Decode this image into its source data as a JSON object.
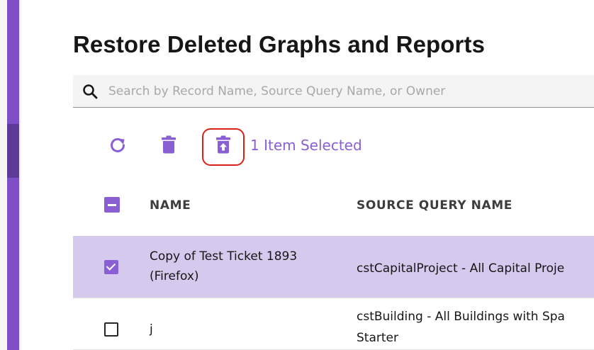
{
  "page": {
    "title": "Restore Deleted Graphs and Reports"
  },
  "search": {
    "placeholder": "Search by Record Name, Source Query Name, or Owner",
    "value": "",
    "icon": "search-icon"
  },
  "toolbar": {
    "refresh_icon": "refresh-icon",
    "delete_icon": "trash-icon",
    "restore_icon": "restore-from-trash-icon",
    "selected_text": "1 Item Selected"
  },
  "table": {
    "columns": [
      "NAME",
      "SOURCE QUERY NAME"
    ],
    "header_checkbox_state": "indeterminate",
    "rows": [
      {
        "selected": true,
        "name_lines": [
          "Copy of Test Ticket 1893",
          "(Firefox)"
        ],
        "source_lines": [
          "cstCapitalProject - All Capital Proje"
        ]
      },
      {
        "selected": false,
        "name_lines": [
          "j"
        ],
        "source_lines": [
          "cstBuilding - All Buildings with Spa",
          "Starter"
        ]
      }
    ]
  },
  "colors": {
    "accent": "#8a5fd4",
    "sidebar": "#7e4fc9",
    "selected_row": "#d6c9ee",
    "highlight_box": "#d9201c"
  }
}
